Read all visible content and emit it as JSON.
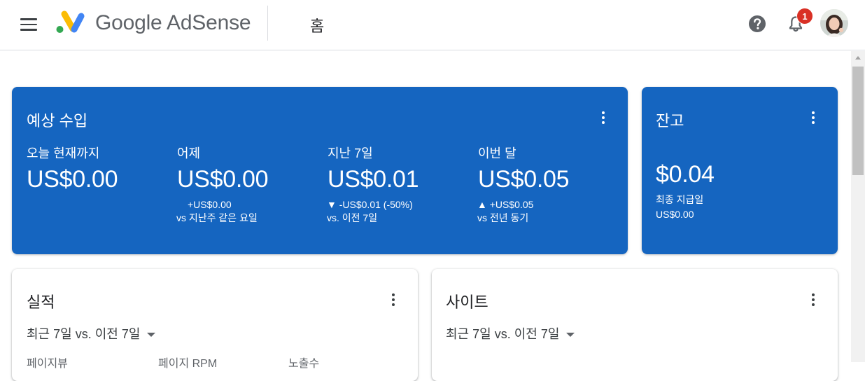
{
  "header": {
    "brand": "Google AdSense",
    "page_title": "홈",
    "notification_count": "1",
    "icons": [
      "menu-icon",
      "adsense-logo",
      "help-icon",
      "bell-icon",
      "avatar"
    ]
  },
  "earnings": {
    "title": "예상 수입",
    "metrics": [
      {
        "label": "오늘 현재까지",
        "value": "US$0.00",
        "change": "",
        "comparison": ""
      },
      {
        "label": "어제",
        "value": "US$0.00",
        "change": "+US$0.00",
        "comparison": "vs 지난주 같은 요일"
      },
      {
        "label": "지난 7일",
        "value": "US$0.01",
        "change": "▼ -US$0.01 (-50%)",
        "comparison": "vs. 이전 7일"
      },
      {
        "label": "이번 달",
        "value": "US$0.05",
        "change": "▲ +US$0.05",
        "comparison": "vs 전년 동기"
      }
    ]
  },
  "balance": {
    "title": "잔고",
    "value": "$0.04",
    "last_payment_label": "최종 지급일",
    "last_payment_value": "US$0.00"
  },
  "performance": {
    "title": "실적",
    "filter_recent": "최근 7일 vs. 이전 7일",
    "columns": [
      "페이지뷰",
      "페이지 RPM",
      "노출수"
    ]
  },
  "sites": {
    "title": "사이트",
    "filter_recent": "최근 7일 vs. 이전 7일"
  },
  "colors": {
    "card_blue": "#1565c0",
    "badge_red": "#d93025"
  }
}
